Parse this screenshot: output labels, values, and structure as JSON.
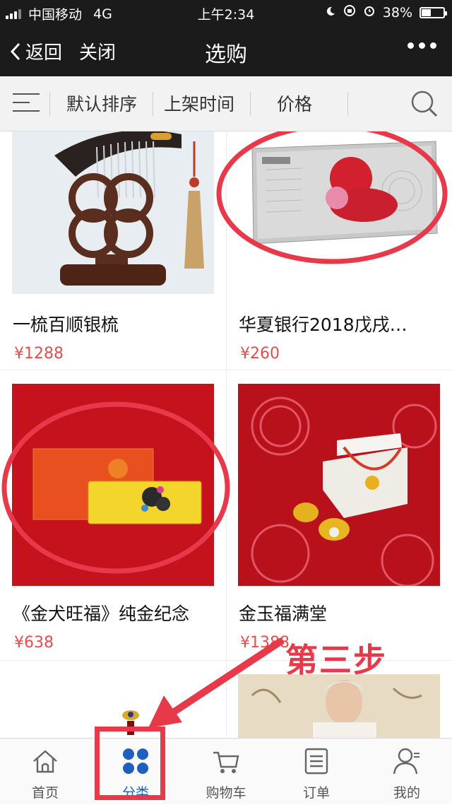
{
  "status_bar": {
    "carrier": "中国移动",
    "network": "4G",
    "time": "上午2:34",
    "battery": "38%",
    "battery_level": 0.38
  },
  "nav": {
    "back_label": "返回",
    "close_label": "关闭",
    "title": "选购"
  },
  "sort_bar": {
    "options": [
      "默认排序",
      "上架时间",
      "价格"
    ]
  },
  "products": [
    {
      "name": "一梳百顺银梳",
      "price": "¥1288"
    },
    {
      "name": "华夏银行2018戊戌…",
      "price": "¥260"
    },
    {
      "name": "《金犬旺福》纯金纪念",
      "price": "¥638"
    },
    {
      "name": "金玉福满堂",
      "price": "¥1388"
    }
  ],
  "annotation": {
    "step_text": "第三步",
    "color": "#e8394a"
  },
  "tabbar": {
    "items": [
      {
        "label": "首页",
        "icon": "home-icon"
      },
      {
        "label": "分类",
        "icon": "category-icon"
      },
      {
        "label": "购物车",
        "icon": "cart-icon"
      },
      {
        "label": "订单",
        "icon": "order-icon"
      },
      {
        "label": "我的",
        "icon": "profile-icon"
      }
    ],
    "active_index": 1,
    "active_color": "#1f5fbf"
  }
}
